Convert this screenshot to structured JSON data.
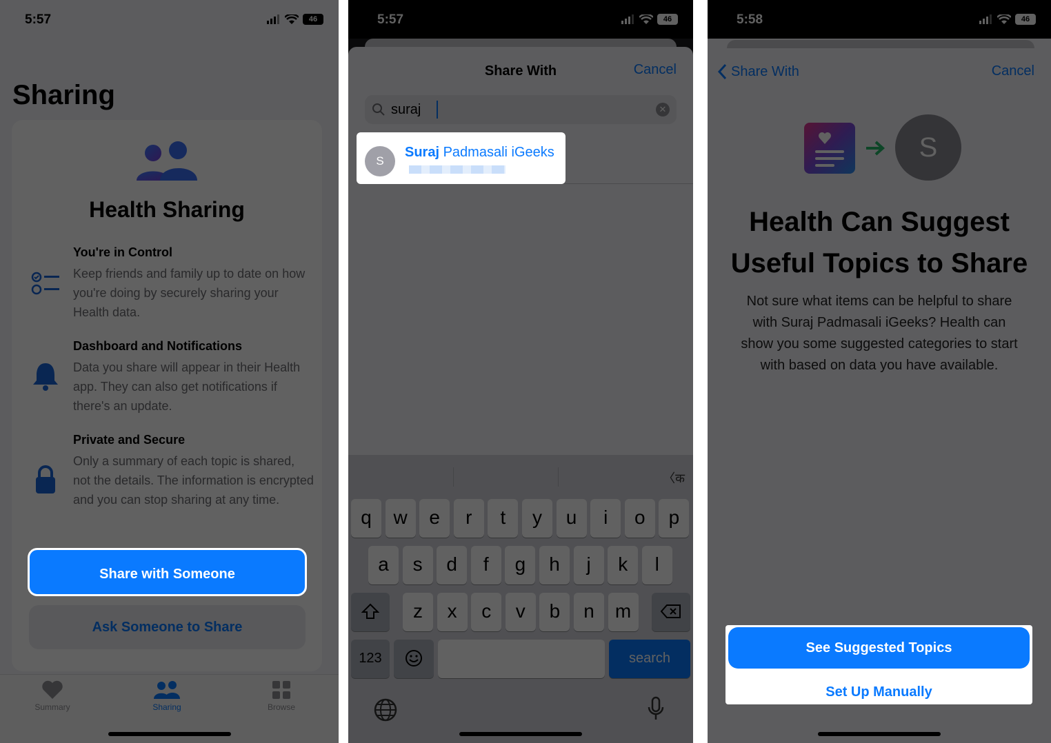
{
  "panels": {
    "sharing": {
      "time": "5:57",
      "battery": "46",
      "title": "Sharing",
      "card_title": "Health Sharing",
      "features": [
        {
          "heading": "You're in Control",
          "body": "Keep friends and family up to date on how you're doing by securely sharing your Health data.",
          "icon": "checklist-icon"
        },
        {
          "heading": "Dashboard and Notifications",
          "body": "Data you share will appear in their Health app. They can also get notifications if there's an update.",
          "icon": "bell-icon"
        },
        {
          "heading": "Private and Secure",
          "body": "Only a summary of each topic is shared, not the details. The information is encrypted and you can stop sharing at any time.",
          "icon": "lock-icon"
        }
      ],
      "share_button": "Share with Someone",
      "ask_button": "Ask Someone to Share",
      "tabs": [
        {
          "label": "Summary",
          "icon": "heart-icon"
        },
        {
          "label": "Sharing",
          "icon": "people-icon"
        },
        {
          "label": "Browse",
          "icon": "grid-icon"
        }
      ]
    },
    "share_with": {
      "time": "5:57",
      "battery": "46",
      "title": "Share With",
      "cancel": "Cancel",
      "search_query": "suraj",
      "contact": {
        "initial": "S",
        "name_match": "Suraj",
        "name_rest": " Padmasali iGeeks"
      },
      "keyboard": {
        "row1": [
          "q",
          "w",
          "e",
          "r",
          "t",
          "y",
          "u",
          "i",
          "o",
          "p"
        ],
        "row2": [
          "a",
          "s",
          "d",
          "f",
          "g",
          "h",
          "j",
          "k",
          "l"
        ],
        "row3": [
          "z",
          "x",
          "c",
          "v",
          "b",
          "n",
          "m"
        ],
        "numbers_key": "123",
        "search_key": "search",
        "lang_hint": "〈क"
      }
    },
    "suggest": {
      "time": "5:58",
      "battery": "46",
      "back": "Share With",
      "cancel": "Cancel",
      "avatar_initial": "S",
      "title": "Health Can Suggest Useful Topics to Share",
      "description": "Not sure what items can be helpful to share with Suraj Padmasali iGeeks? Health can show you some suggested categories to start with based on data you have available.",
      "primary_button": "See Suggested Topics",
      "secondary_button": "Set Up Manually"
    }
  },
  "colors": {
    "accent": "#0a7aff",
    "background": "#f2f2f7"
  }
}
